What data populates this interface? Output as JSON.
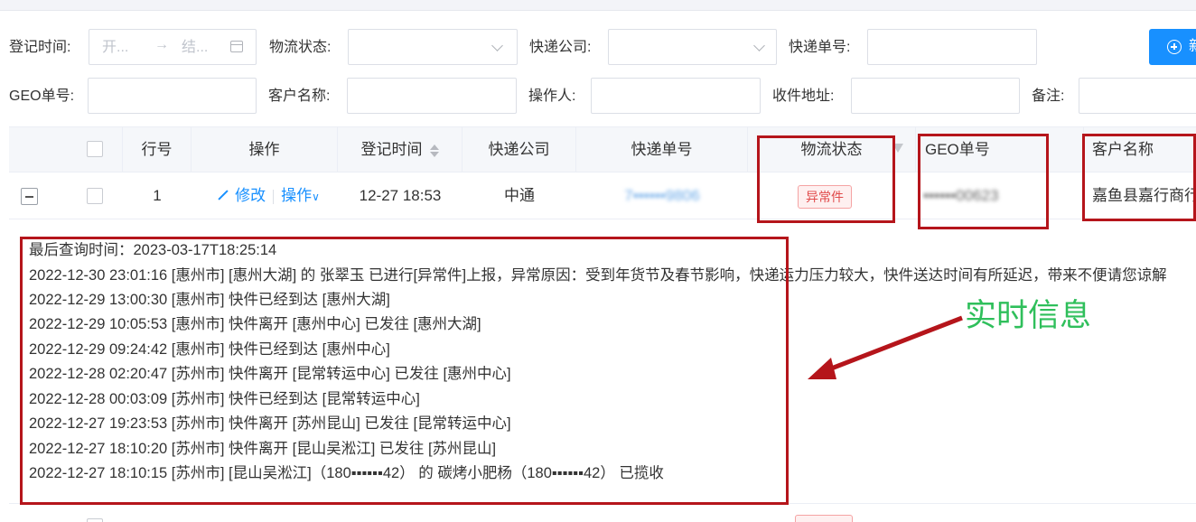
{
  "filters": {
    "reg_time_label": "登记时间:",
    "date_start_placeholder": "开...",
    "date_arrow": "→",
    "date_end_placeholder": "结...",
    "logistics_status_label": "物流状态:",
    "courier_label": "快递公司:",
    "tracking_no_label": "快递单号:",
    "geo_no_label": "GEO单号:",
    "customer_label": "客户名称:",
    "operator_label": "操作人:",
    "address_label": "收件地址:",
    "remark_label": "备注:",
    "add_button_label": "新"
  },
  "table": {
    "headers": {
      "row_no": "行号",
      "actions": "操作",
      "reg_time": "登记时间",
      "courier": "快递公司",
      "tracking_no": "快递单号",
      "status": "物流状态",
      "geo_no": "GEO单号",
      "customer": "客户名称"
    },
    "rows": [
      {
        "row_no": "1",
        "edit_label": "修改",
        "more_label": "操作",
        "more_chevron": "∨",
        "reg_time": "12-27 18:53",
        "courier": "中通",
        "tracking_no": "7▪▪▪▪▪▪9806",
        "status": "异常件",
        "geo_no": "▪▪▪▪▪▪00623",
        "customer": "嘉鱼县嘉行商行"
      }
    ],
    "detail": {
      "lines": [
        "最后查询时间：2023-03-17T18:25:14",
        "2022-12-30 23:01:16 [惠州市] [惠州大湖] 的 张翠玉 已进行[异常件]上报，异常原因：受到年货节及春节影响，快递运力压力较大，快件送达时间有所延迟，带来不便请您谅解",
        "2022-12-29 13:00:30 [惠州市] 快件已经到达 [惠州大湖]",
        "2022-12-29 10:05:53 [惠州市] 快件离开 [惠州中心] 已发往 [惠州大湖]",
        "2022-12-29 09:24:42 [惠州市] 快件已经到达 [惠州中心]",
        "2022-12-28 02:20:47 [苏州市] 快件离开 [昆常转运中心] 已发往 [惠州中心]",
        "2022-12-28 00:03:09 [苏州市] 快件已经到达 [昆常转运中心]",
        "2022-12-27 19:23:53 [苏州市] 快件离开 [苏州昆山] 已发往 [昆常转运中心]",
        "2022-12-27 18:10:20 [苏州市] 快件离开 [昆山吴淞江] 已发往 [苏州昆山]",
        "2022-12-27 18:10:15 [苏州市] [昆山吴淞江]（180▪▪▪▪▪▪42） 的 碳烤小肥杨（180▪▪▪▪▪▪42） 已揽收"
      ]
    }
  },
  "annotation": {
    "callout_text": "实时信息",
    "color_callout": "#2fbf5b",
    "color_box": "#b5151b"
  }
}
